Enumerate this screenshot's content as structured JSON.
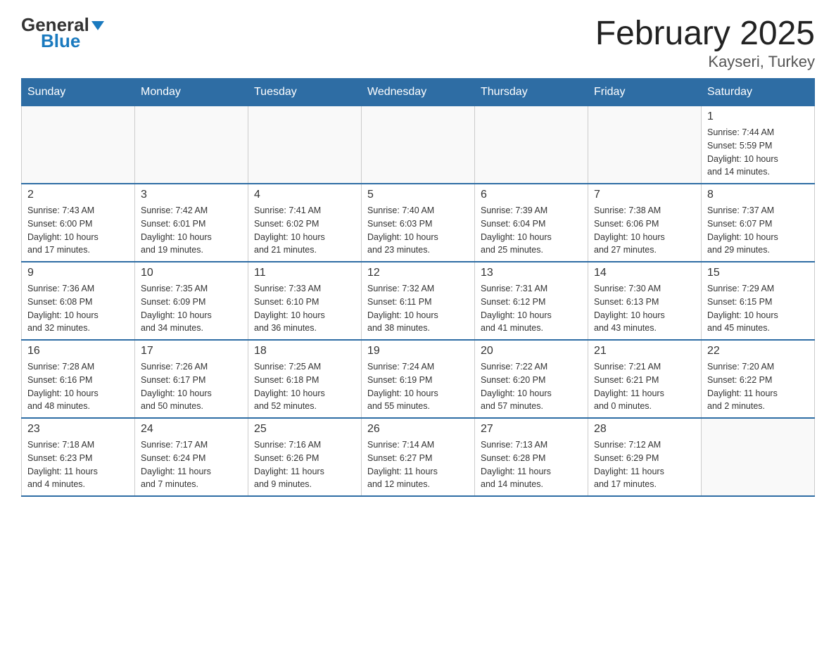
{
  "logo": {
    "general": "General",
    "blue": "Blue",
    "triangle_label": "logo-triangle"
  },
  "title": "February 2025",
  "subtitle": "Kayseri, Turkey",
  "days_of_week": [
    "Sunday",
    "Monday",
    "Tuesday",
    "Wednesday",
    "Thursday",
    "Friday",
    "Saturday"
  ],
  "weeks": [
    [
      {
        "day": "",
        "info": ""
      },
      {
        "day": "",
        "info": ""
      },
      {
        "day": "",
        "info": ""
      },
      {
        "day": "",
        "info": ""
      },
      {
        "day": "",
        "info": ""
      },
      {
        "day": "",
        "info": ""
      },
      {
        "day": "1",
        "info": "Sunrise: 7:44 AM\nSunset: 5:59 PM\nDaylight: 10 hours\nand 14 minutes."
      }
    ],
    [
      {
        "day": "2",
        "info": "Sunrise: 7:43 AM\nSunset: 6:00 PM\nDaylight: 10 hours\nand 17 minutes."
      },
      {
        "day": "3",
        "info": "Sunrise: 7:42 AM\nSunset: 6:01 PM\nDaylight: 10 hours\nand 19 minutes."
      },
      {
        "day": "4",
        "info": "Sunrise: 7:41 AM\nSunset: 6:02 PM\nDaylight: 10 hours\nand 21 minutes."
      },
      {
        "day": "5",
        "info": "Sunrise: 7:40 AM\nSunset: 6:03 PM\nDaylight: 10 hours\nand 23 minutes."
      },
      {
        "day": "6",
        "info": "Sunrise: 7:39 AM\nSunset: 6:04 PM\nDaylight: 10 hours\nand 25 minutes."
      },
      {
        "day": "7",
        "info": "Sunrise: 7:38 AM\nSunset: 6:06 PM\nDaylight: 10 hours\nand 27 minutes."
      },
      {
        "day": "8",
        "info": "Sunrise: 7:37 AM\nSunset: 6:07 PM\nDaylight: 10 hours\nand 29 minutes."
      }
    ],
    [
      {
        "day": "9",
        "info": "Sunrise: 7:36 AM\nSunset: 6:08 PM\nDaylight: 10 hours\nand 32 minutes."
      },
      {
        "day": "10",
        "info": "Sunrise: 7:35 AM\nSunset: 6:09 PM\nDaylight: 10 hours\nand 34 minutes."
      },
      {
        "day": "11",
        "info": "Sunrise: 7:33 AM\nSunset: 6:10 PM\nDaylight: 10 hours\nand 36 minutes."
      },
      {
        "day": "12",
        "info": "Sunrise: 7:32 AM\nSunset: 6:11 PM\nDaylight: 10 hours\nand 38 minutes."
      },
      {
        "day": "13",
        "info": "Sunrise: 7:31 AM\nSunset: 6:12 PM\nDaylight: 10 hours\nand 41 minutes."
      },
      {
        "day": "14",
        "info": "Sunrise: 7:30 AM\nSunset: 6:13 PM\nDaylight: 10 hours\nand 43 minutes."
      },
      {
        "day": "15",
        "info": "Sunrise: 7:29 AM\nSunset: 6:15 PM\nDaylight: 10 hours\nand 45 minutes."
      }
    ],
    [
      {
        "day": "16",
        "info": "Sunrise: 7:28 AM\nSunset: 6:16 PM\nDaylight: 10 hours\nand 48 minutes."
      },
      {
        "day": "17",
        "info": "Sunrise: 7:26 AM\nSunset: 6:17 PM\nDaylight: 10 hours\nand 50 minutes."
      },
      {
        "day": "18",
        "info": "Sunrise: 7:25 AM\nSunset: 6:18 PM\nDaylight: 10 hours\nand 52 minutes."
      },
      {
        "day": "19",
        "info": "Sunrise: 7:24 AM\nSunset: 6:19 PM\nDaylight: 10 hours\nand 55 minutes."
      },
      {
        "day": "20",
        "info": "Sunrise: 7:22 AM\nSunset: 6:20 PM\nDaylight: 10 hours\nand 57 minutes."
      },
      {
        "day": "21",
        "info": "Sunrise: 7:21 AM\nSunset: 6:21 PM\nDaylight: 11 hours\nand 0 minutes."
      },
      {
        "day": "22",
        "info": "Sunrise: 7:20 AM\nSunset: 6:22 PM\nDaylight: 11 hours\nand 2 minutes."
      }
    ],
    [
      {
        "day": "23",
        "info": "Sunrise: 7:18 AM\nSunset: 6:23 PM\nDaylight: 11 hours\nand 4 minutes."
      },
      {
        "day": "24",
        "info": "Sunrise: 7:17 AM\nSunset: 6:24 PM\nDaylight: 11 hours\nand 7 minutes."
      },
      {
        "day": "25",
        "info": "Sunrise: 7:16 AM\nSunset: 6:26 PM\nDaylight: 11 hours\nand 9 minutes."
      },
      {
        "day": "26",
        "info": "Sunrise: 7:14 AM\nSunset: 6:27 PM\nDaylight: 11 hours\nand 12 minutes."
      },
      {
        "day": "27",
        "info": "Sunrise: 7:13 AM\nSunset: 6:28 PM\nDaylight: 11 hours\nand 14 minutes."
      },
      {
        "day": "28",
        "info": "Sunrise: 7:12 AM\nSunset: 6:29 PM\nDaylight: 11 hours\nand 17 minutes."
      },
      {
        "day": "",
        "info": ""
      }
    ]
  ],
  "accent_color": "#2e6da4"
}
